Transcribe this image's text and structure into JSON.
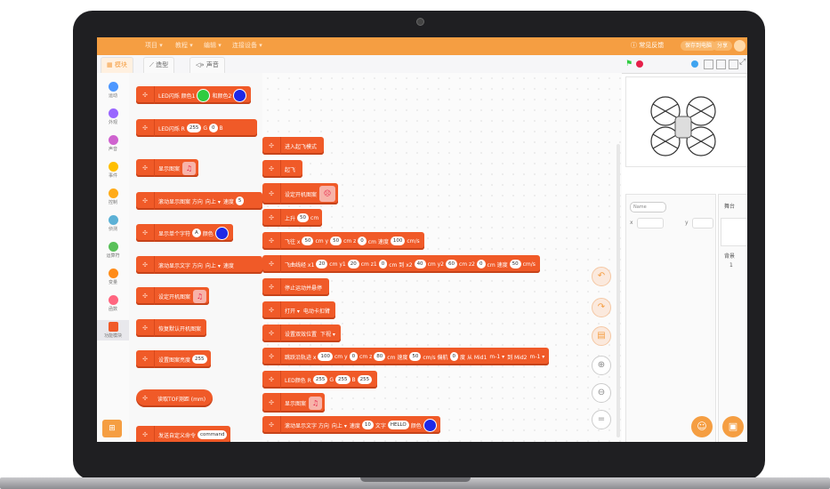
{
  "menu": {
    "items": [
      "项目 ▾",
      "教程 ▾",
      "编辑 ▾",
      "连接设备 ▾"
    ],
    "help": "ⓘ 常见反馈",
    "pill_1": "保存到电脑",
    "pill_2": "分享"
  },
  "tabs": {
    "blocks": "▦ 模块",
    "costumes": "⟋ 造型",
    "sounds": "◁» 声音"
  },
  "categories": [
    {
      "label": "运动",
      "color": "#4c97ff"
    },
    {
      "label": "外观",
      "color": "#9966ff"
    },
    {
      "label": "声音",
      "color": "#cf63cf"
    },
    {
      "label": "事件",
      "color": "#ffbf00"
    },
    {
      "label": "控制",
      "color": "#ffab19"
    },
    {
      "label": "侦测",
      "color": "#5cb1d6"
    },
    {
      "label": "运算符",
      "color": "#59c059"
    },
    {
      "label": "变量",
      "color": "#ff8c1a"
    },
    {
      "label": "函数",
      "color": "#ff6680"
    },
    {
      "label": "功能模块",
      "color": "#f05a28"
    }
  ],
  "palette": {
    "b1": {
      "label": "LED闪烁 颜色1",
      "label2": "和颜色2"
    },
    "b2": {
      "label": "LED闪烁 R",
      "r": "255",
      "g_lbl": "G",
      "g": "0",
      "b_lbl": "B"
    },
    "b3": {
      "label": "显示图案"
    },
    "b4": {
      "label": "滚动显示图案 方向",
      "dir": "向上 ▾",
      "speed_lbl": "速度",
      "speed": "5"
    },
    "b5": {
      "label": "显示单个字符",
      "ch": "A",
      "color_lbl": "颜色"
    },
    "b6": {
      "label": "滚动显示文字 方向",
      "dir": "向上 ▾",
      "speed_lbl": "速度"
    },
    "b7": {
      "label": "设定开机图案"
    },
    "b8": {
      "label": "恢复默认开机图案"
    },
    "b9": {
      "label": "设置图案亮度",
      "val": "255"
    },
    "b10": {
      "label": "读取TOF测距 (mm)"
    },
    "b11": {
      "label": "发送自定义命令",
      "val": "command"
    }
  },
  "script": {
    "s1": {
      "label": "进入起飞模式"
    },
    "s2": {
      "label": "起飞"
    },
    "s3": {
      "label": "设定开机图案"
    },
    "s4": {
      "label": "上升",
      "val": "50",
      "unit": "cm"
    },
    "s5": {
      "x_lbl": "飞往 x",
      "x": "50",
      "y_lbl": "cm y",
      "y": "50",
      "z_lbl": "cm z",
      "z": "0",
      "sp_lbl": "cm 速度",
      "sp": "100",
      "unit": "cm/s"
    },
    "s6": {
      "p1": "飞曲线经 x1",
      "x1": "20",
      "p2": "cm y1",
      "y1": "20",
      "p3": "cm z1",
      "z1": "0",
      "p4": "cm 到 x2",
      "x2": "40",
      "p5": "cm y2",
      "y2": "60",
      "p6": "cm z2",
      "z2": "0",
      "p7": "cm 速度",
      "sp": "50",
      "unit": "cm/s"
    },
    "s7": {
      "label": "停止运动并悬停"
    },
    "s8": {
      "label": "打开 ▾",
      "label2": "电动卡扣臂"
    },
    "s9": {
      "label": "设置双效位置",
      "val": "下视 ▾"
    },
    "s10": {
      "p1": "跳跃沿轨迹 x",
      "x": "100",
      "p2": "cm y",
      "y": "0",
      "p3": "cm z",
      "z": "80",
      "p4": "cm 速度",
      "sp": "50",
      "p5": "cm/s 偏航",
      "yaw": "0",
      "p6": "度 从 Mid1",
      "m1": "m-1 ▾",
      "p7": "到 Mid2",
      "m2": "m-1 ▾"
    },
    "s11": {
      "label": "LED颜色 R",
      "r": "255",
      "g_lbl": "G",
      "g": "255",
      "b_lbl": "B",
      "b": "255"
    },
    "s12": {
      "label": "显示图案"
    },
    "s13": {
      "label": "滚动显示文字 方向",
      "dir": "向上 ▾",
      "speed_lbl": "速度",
      "speed": "10",
      "text_lbl": "文字",
      "text": "HELLO",
      "color_lbl": "颜色"
    }
  },
  "sprite": {
    "name_placeholder": "Name",
    "x_lbl": "x",
    "y_lbl": "y"
  },
  "side": {
    "title": "舞台",
    "bg_lbl": "背景",
    "bg_count": "1"
  },
  "colors": {
    "accent": "#f59e42",
    "block": "#f05a28",
    "green": "#2ecc40",
    "blue": "#1e28e6"
  }
}
